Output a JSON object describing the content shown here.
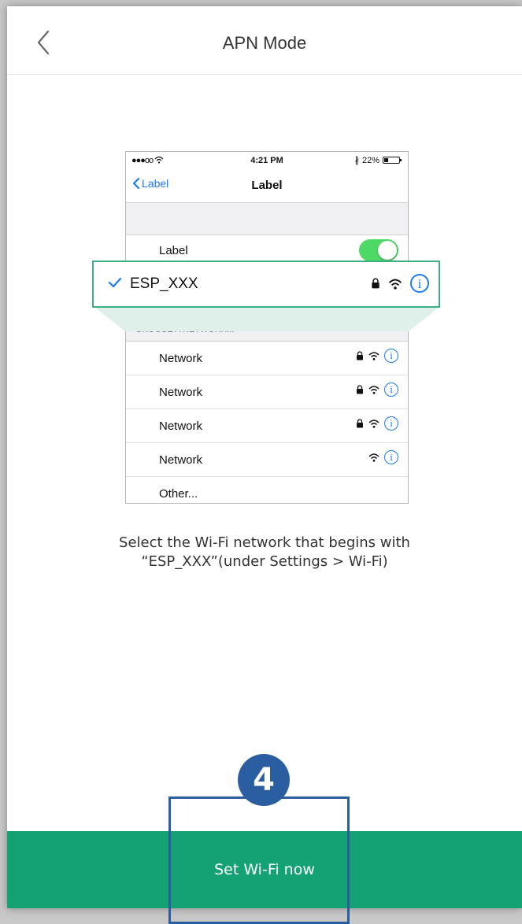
{
  "header": {
    "title": "APN Mode",
    "back_icon": "chevron-left-icon"
  },
  "phone": {
    "status_bar": {
      "signal": "●●●oo",
      "time": "4:21 PM",
      "battery": "22%"
    },
    "nav": {
      "back_label": "Label",
      "title": "Label"
    },
    "toggle_row": {
      "label": "Label",
      "toggle_on": true
    },
    "selected_network": {
      "name": "ESP_XXX",
      "locked": true
    },
    "choose_header": "CHOOSE A NETWORK...",
    "networks": [
      {
        "name": "Network",
        "locked": true
      },
      {
        "name": "Network",
        "locked": true
      },
      {
        "name": "Network",
        "locked": true
      },
      {
        "name": "Network",
        "locked": false
      }
    ],
    "other_label": "Other..."
  },
  "instruction": {
    "line1": "Select the Wi-Fi network that begins with",
    "line2": "“ESP_XXX”(under Settings > Wi-Fi)"
  },
  "action": {
    "label": "Set Wi-Fi now"
  },
  "callout": {
    "number": "4"
  },
  "colors": {
    "accent": "#12a273",
    "highlight": "#3dae82",
    "callout": "#2b5ea0",
    "ios_blue": "#1a7cf3",
    "toggle_green": "#4cd964"
  }
}
